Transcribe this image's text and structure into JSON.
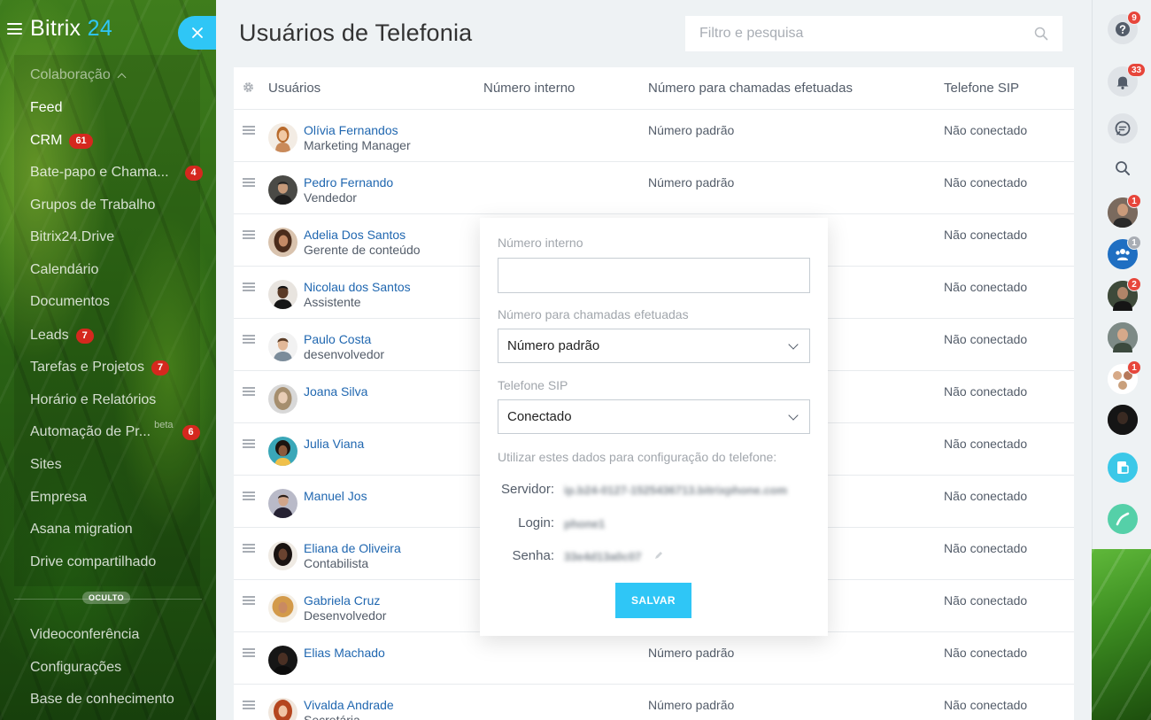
{
  "app": {
    "brand": "Bitrix",
    "brand_num": "24"
  },
  "sidebar": {
    "items": [
      {
        "label": "Colaboração",
        "top": 0
      },
      {
        "label": "Feed"
      },
      {
        "label": "CRM",
        "badge": "61"
      },
      {
        "label": "Bate-papo e Chama...",
        "badge": "4"
      },
      {
        "label": "Grupos de Trabalho"
      },
      {
        "label": "Bitrix24.Drive"
      },
      {
        "label": "Calendário"
      },
      {
        "label": "Documentos"
      },
      {
        "label": "Leads",
        "badge": "7"
      },
      {
        "label": "Tarefas e Projetos",
        "badge": "7"
      },
      {
        "label": "Horário e Relatórios"
      },
      {
        "label": "Automação de Pr...",
        "sup": "beta",
        "badge": "6"
      },
      {
        "label": "Sites"
      },
      {
        "label": "Empresa"
      },
      {
        "label": "Asana migration"
      },
      {
        "label": "Drive compartilhado"
      },
      {
        "label": "Videoconferência"
      },
      {
        "label": "Configurações"
      },
      {
        "label": "Base de conhecimento"
      }
    ],
    "hidden_label": "OCULTO"
  },
  "header": {
    "title": "Usuários de Telefonia",
    "search_placeholder": "Filtro e pesquisa"
  },
  "grid": {
    "columns": [
      "Usuários",
      "Número interno",
      "Número para chamadas efetuadas",
      "Telefone SIP"
    ],
    "rows": [
      {
        "name": "Olívia Fernandos",
        "position": "Marketing Manager",
        "outgoing": "Número padrão",
        "sip": "Não conectado"
      },
      {
        "name": "Pedro Fernando",
        "position": "Vendedor",
        "outgoing": "Número padrão",
        "sip": "Não conectado"
      },
      {
        "name": "Adelia Dos Santos",
        "position": "Gerente de conteúdo",
        "outgoing": "",
        "sip": "Não conectado"
      },
      {
        "name": "Nicolau dos Santos",
        "position": "Assistente",
        "outgoing": "",
        "sip": "Não conectado"
      },
      {
        "name": "Paulo Costa",
        "position": "desenvolvedor",
        "outgoing": "",
        "sip": "Não conectado"
      },
      {
        "name": "Joana Silva",
        "position": "",
        "outgoing": "",
        "sip": "Não conectado"
      },
      {
        "name": "Julia Viana",
        "position": "",
        "outgoing": "",
        "sip": "Não conectado"
      },
      {
        "name": "Manuel Jos",
        "position": "",
        "outgoing": "",
        "sip": "Não conectado"
      },
      {
        "name": "Eliana de Oliveira",
        "position": "Contabilista",
        "outgoing": "",
        "sip": "Não conectado"
      },
      {
        "name": "Gabriela Cruz",
        "position": "Desenvolvedor",
        "outgoing": "",
        "sip": "Não conectado"
      },
      {
        "name": "Elias Machado",
        "position": "",
        "outgoing": "Número padrão",
        "sip": "Não conectado"
      },
      {
        "name": "Vivalda Andrade",
        "position": "Secretária",
        "outgoing": "Número padrão",
        "sip": "Não conectado"
      }
    ]
  },
  "popup": {
    "internal_label": "Número interno",
    "internal_value": "",
    "outgoing_label": "Número para chamadas efetuadas",
    "outgoing_value": "Número padrão",
    "sip_label": "Telefone SIP",
    "sip_value": "Conectado",
    "config_label": "Utilizar estes dados para configuração do telefone:",
    "server_key": "Servidor:",
    "server_value": "ip.b24-0127-1525436713.bitrixphone.com",
    "login_key": "Login:",
    "login_value": "phone1",
    "password_key": "Senha:",
    "password_value": "33e4d13a0c07",
    "save_label": "SALVAR"
  },
  "right_panel": {
    "help_badge": "9",
    "notifications_badge": "33",
    "chat_badges": [
      "1",
      "1",
      "2",
      "",
      "1",
      ""
    ]
  },
  "colors": {
    "accent": "#2fc6f6",
    "link": "#2067b0",
    "badge_red": "#d5281e",
    "call_green": "#55d0a8"
  }
}
